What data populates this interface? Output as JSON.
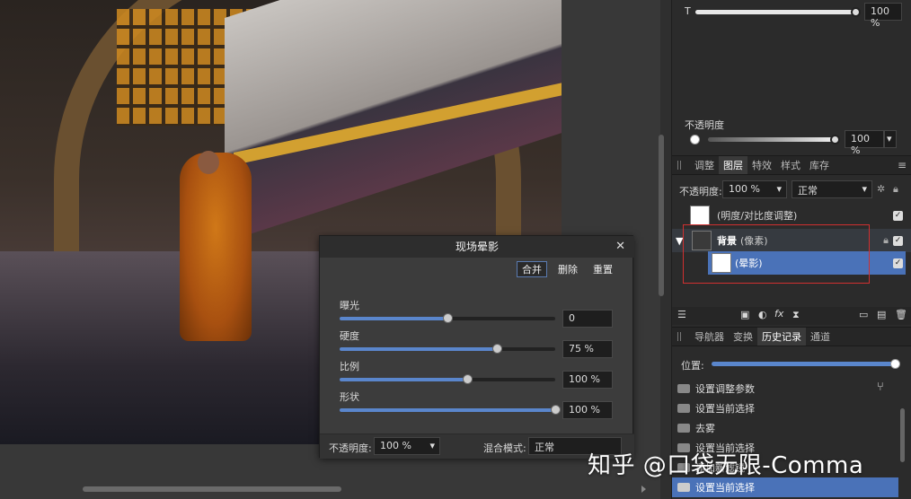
{
  "opacity_top": {
    "t_label": "T",
    "t_value": "100 %",
    "label": "不透明度",
    "value": "100 %"
  },
  "panels1": {
    "tabs": [
      "调整",
      "图层",
      "特效",
      "样式",
      "库存"
    ],
    "active": 1
  },
  "layers_bar": {
    "opacity_label": "不透明度:",
    "opacity_value": "100 %",
    "blend_mode": "正常"
  },
  "layers": [
    {
      "name": "(明度/对比度调整)",
      "checked": true
    },
    {
      "name": "背景",
      "suffix": "(像素)",
      "checked": true,
      "locked": true
    },
    {
      "name": "(晕影)",
      "checked": true,
      "selected": true
    }
  ],
  "panels2": {
    "tabs": [
      "导航器",
      "变换",
      "历史记录",
      "通道"
    ],
    "active": 2
  },
  "history": {
    "position_label": "位置:",
    "items": [
      "设置调整参数",
      "设置当前选择",
      "去雾",
      "设置当前选择",
      "添加新滤镜",
      "设置当前选择"
    ]
  },
  "dialog": {
    "title": "现场晕影",
    "buttons": [
      "合并",
      "删除",
      "重置"
    ],
    "sliders": [
      {
        "label": "曝光",
        "value": "0",
        "level": 0.5
      },
      {
        "label": "硬度",
        "value": "75 %",
        "level": 0.73
      },
      {
        "label": "比例",
        "value": "100 %",
        "level": 0.59
      },
      {
        "label": "形状",
        "value": "100 %",
        "level": 1.0
      }
    ],
    "opacity_label": "不透明度:",
    "opacity_value": "100 %",
    "blend_label": "混合模式:",
    "blend_value": "正常"
  },
  "watermark": "知乎 @口袋无限-Comma",
  "colors": {
    "accent": "#5a86cc",
    "selection": "#4a72b8",
    "highlight_box": "#d03030"
  }
}
